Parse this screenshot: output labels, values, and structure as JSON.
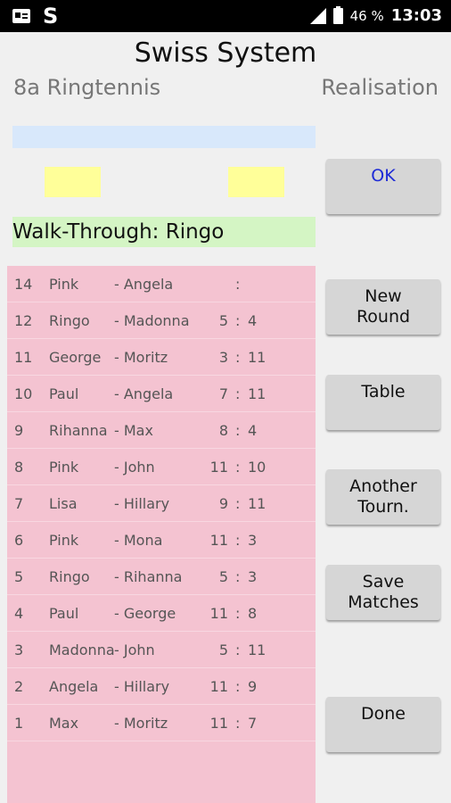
{
  "status_bar": {
    "left_letter": "S",
    "battery": "46 %",
    "time": "13:03"
  },
  "header": {
    "title": "Swiss System",
    "subtitle": "8a Ringtennis",
    "mode": "Realisation"
  },
  "walk_through": "Walk-Through: Ringo",
  "buttons": {
    "ok": "OK",
    "new_round": "New\nRound",
    "table": "Table",
    "another_tourn": "Another\nTourn.",
    "save_matches": "Save\nMatches",
    "done": "Done"
  },
  "matches": [
    {
      "num": "14",
      "p1": "Pink",
      "p2": "- Angela",
      "s1": "",
      "sep": ":",
      "s2": ""
    },
    {
      "num": "12",
      "p1": "Ringo",
      "p2": "- Madonna",
      "s1": "5",
      "sep": ":",
      "s2": "4"
    },
    {
      "num": "11",
      "p1": "George",
      "p2": "- Moritz",
      "s1": "3",
      "sep": ":",
      "s2": "11"
    },
    {
      "num": "10",
      "p1": "Paul",
      "p2": "- Angela",
      "s1": "7",
      "sep": ":",
      "s2": "11"
    },
    {
      "num": "9",
      "p1": "Rihanna",
      "p2": "- Max",
      "s1": "8",
      "sep": ":",
      "s2": "4"
    },
    {
      "num": "8",
      "p1": "Pink",
      "p2": "- John",
      "s1": "11",
      "sep": ":",
      "s2": "10"
    },
    {
      "num": "7",
      "p1": "Lisa",
      "p2": "- Hillary",
      "s1": "9",
      "sep": ":",
      "s2": "11"
    },
    {
      "num": "6",
      "p1": "Pink",
      "p2": "- Mona",
      "s1": "11",
      "sep": ":",
      "s2": "3"
    },
    {
      "num": "5",
      "p1": "Ringo",
      "p2": "- Rihanna",
      "s1": "5",
      "sep": ":",
      "s2": "3"
    },
    {
      "num": "4",
      "p1": "Paul",
      "p2": "- George",
      "s1": "11",
      "sep": ":",
      "s2": "8"
    },
    {
      "num": "3",
      "p1": "Madonna",
      "p2": "- John",
      "s1": "5",
      "sep": ":",
      "s2": "11"
    },
    {
      "num": "2",
      "p1": "Angela",
      "p2": "- Hillary",
      "s1": "11",
      "sep": ":",
      "s2": "9"
    },
    {
      "num": "1",
      "p1": "Max",
      "p2": "- Moritz",
      "s1": "11",
      "sep": ":",
      "s2": "7"
    }
  ]
}
